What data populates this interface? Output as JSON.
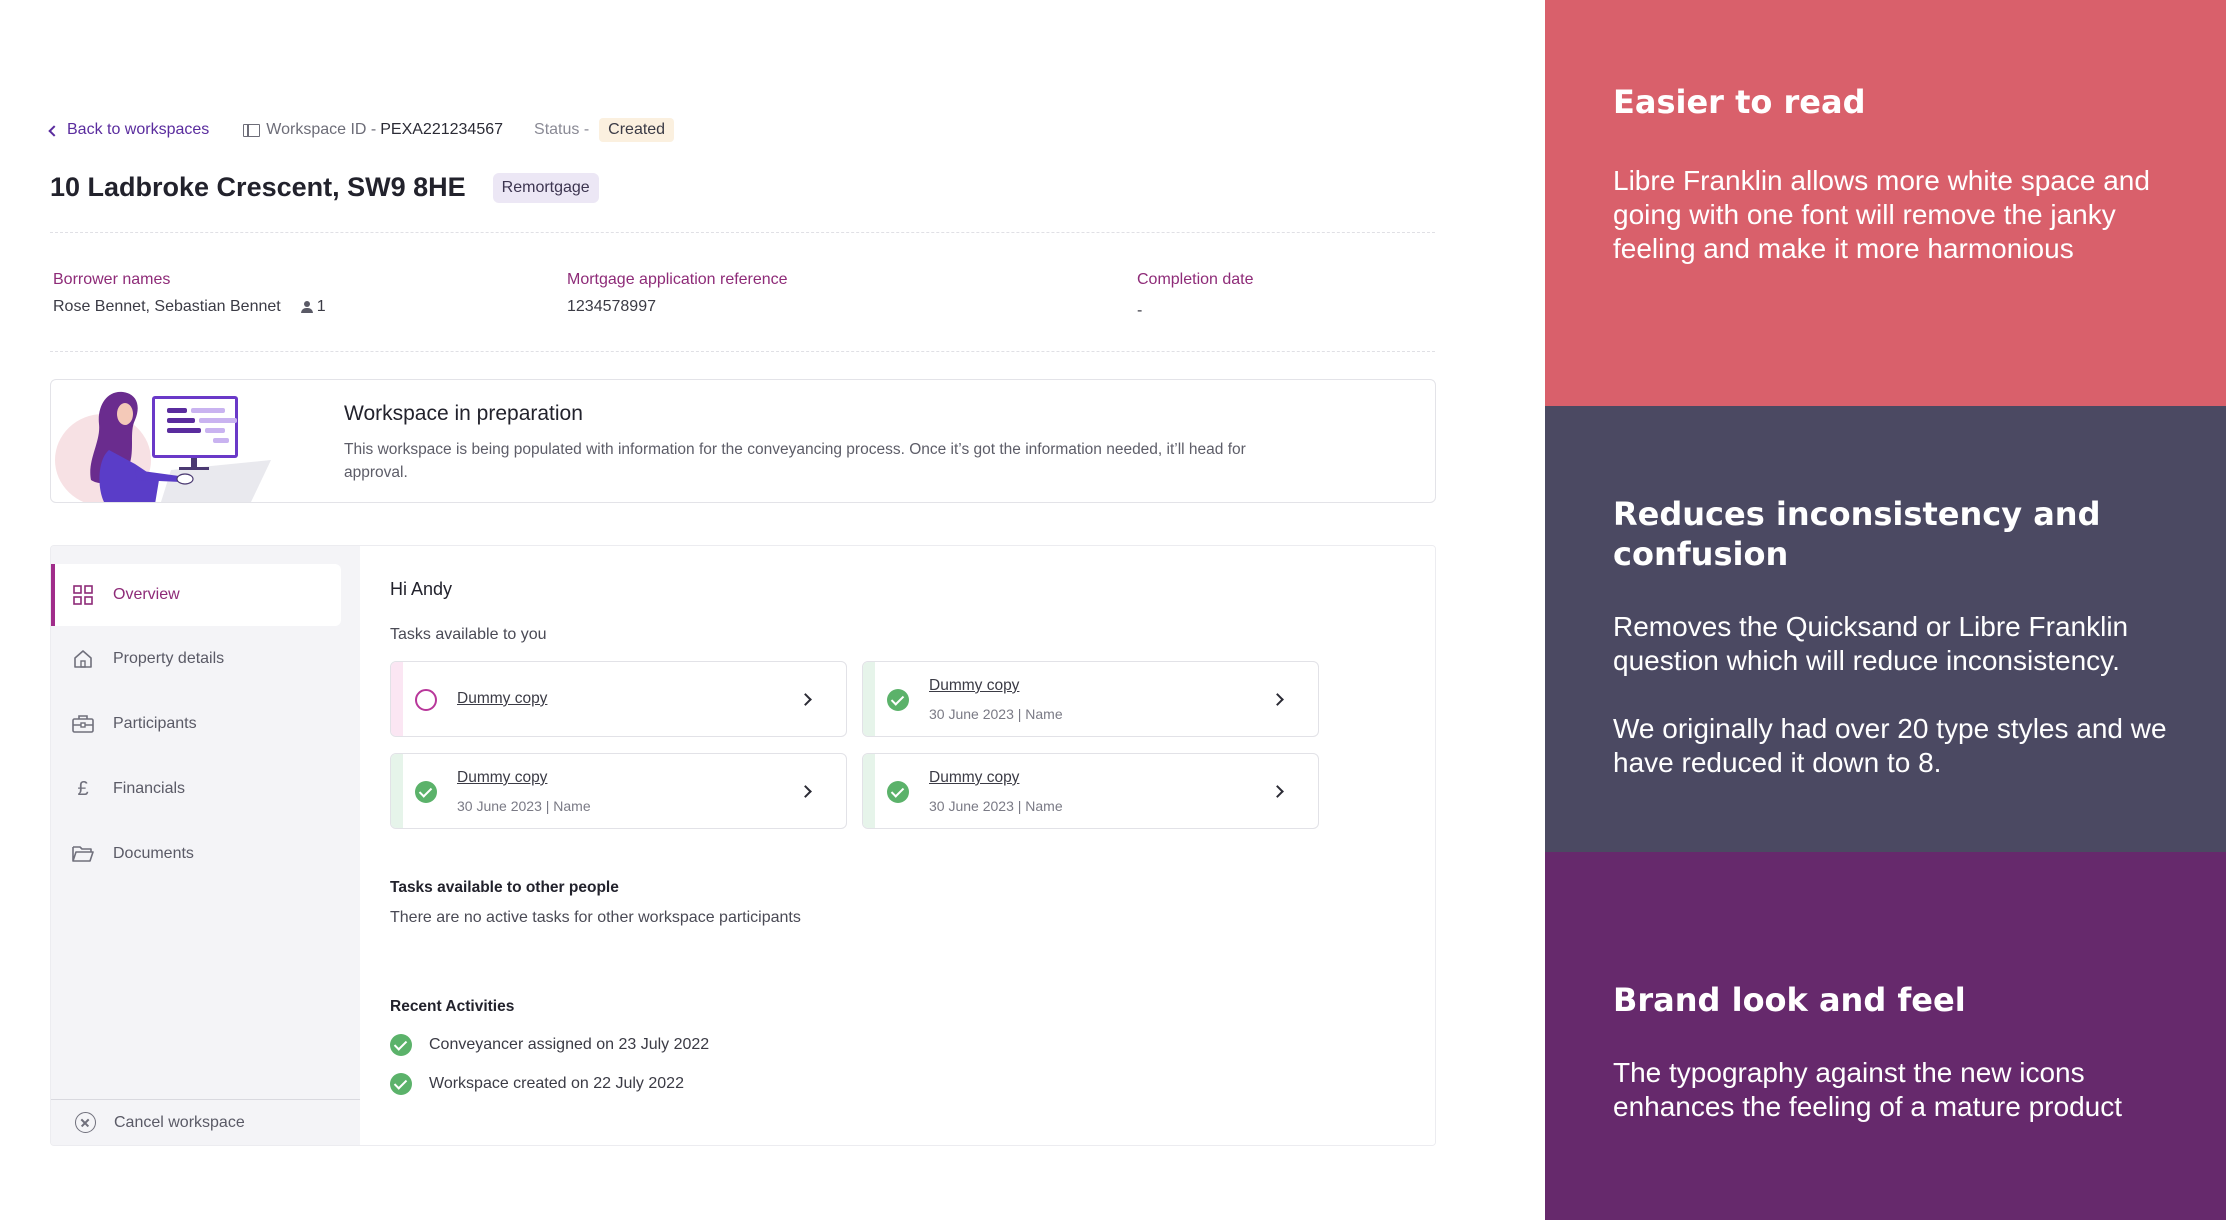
{
  "topbar": {
    "back_label": "Back to workspaces",
    "workspace_id_label": "Workspace ID -",
    "workspace_id_value": "PEXA221234567",
    "status_label": "Status -",
    "status_value": "Created"
  },
  "header": {
    "title": "10 Ladbroke Crescent, SW9 8HE",
    "tag": "Remortgage"
  },
  "info": {
    "borrower_label": "Borrower names",
    "borrower_value": "Rose Bennet, Sebastian Bennet",
    "borrower_count": "1",
    "mortgage_label": "Mortgage application reference",
    "mortgage_value": "1234578997",
    "completion_label": "Completion date",
    "completion_value": "-"
  },
  "banner": {
    "title": "Workspace in preparation",
    "text": "This workspace is being populated with information for the conveyancing process. Once it’s got the information needed, it’ll head for approval."
  },
  "sidebar": {
    "items": [
      {
        "label": "Overview",
        "icon": "grid-icon",
        "active": true
      },
      {
        "label": "Property details",
        "icon": "home-icon",
        "active": false
      },
      {
        "label": "Participants",
        "icon": "briefcase-icon",
        "active": false
      },
      {
        "label": "Financials",
        "icon": "pound-icon",
        "active": false
      },
      {
        "label": "Documents",
        "icon": "folder-icon",
        "active": false
      }
    ],
    "cancel_label": "Cancel workspace"
  },
  "main": {
    "greeting": "Hi Andy",
    "tasks_heading": "Tasks available to you",
    "tasks": [
      {
        "label": "Dummy copy",
        "meta": "",
        "status": "pending"
      },
      {
        "label": "Dummy copy",
        "meta": "30 June 2023 | Name",
        "status": "done"
      },
      {
        "label": "Dummy copy",
        "meta": "30 June 2023 | Name",
        "status": "done"
      },
      {
        "label": "Dummy copy",
        "meta": "30 June 2023 | Name",
        "status": "done"
      }
    ],
    "others_heading": "Tasks available to other people",
    "others_text": "There are no active tasks for other workspace participants",
    "activities_heading": "Recent Activities",
    "activities": [
      "Conveyancer assigned on 23 July 2022",
      "Workspace created on 22 July 2022"
    ]
  },
  "notes": [
    {
      "heading": "Easier to read",
      "body": "Libre Franklin allows more white space and going with one font will remove the janky feeling and make it more harmonious",
      "color": "#d9606b"
    },
    {
      "heading": "Reduces inconsistency and confusion",
      "body": "Removes the Quicksand or Libre Franklin question which will reduce inconsistency.",
      "body2": "We originally had over 20 type styles and we have reduced it down to 8.",
      "color": "#4b4962"
    },
    {
      "heading": "Brand look and feel",
      "body": "The typography against the new icons enhances the feeling of a mature product",
      "color": "#66296c"
    }
  ],
  "colors": {
    "accent": "#8e2b78",
    "link": "#5a2c9e",
    "success": "#5bb26a",
    "status_badge_bg": "#fbf0df",
    "tag_bg": "#ece7f5"
  }
}
